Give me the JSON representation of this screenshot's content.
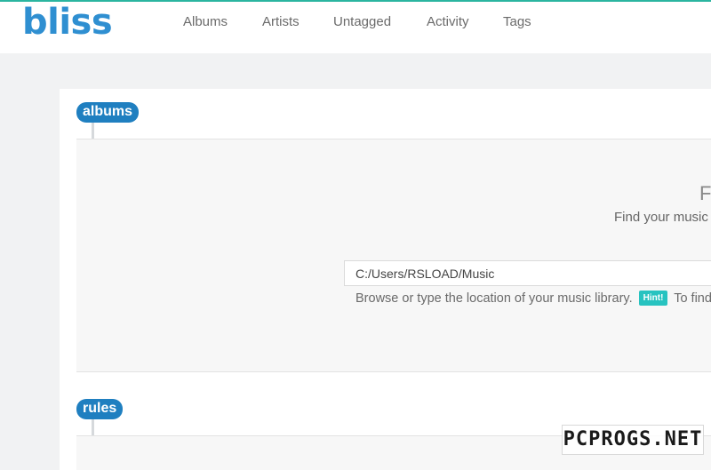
{
  "app": {
    "logo": "bliss"
  },
  "nav": {
    "items": [
      {
        "label": "Albums"
      },
      {
        "label": "Artists"
      },
      {
        "label": "Untagged"
      },
      {
        "label": "Activity"
      },
      {
        "label": "Tags"
      }
    ]
  },
  "sections": {
    "albums": {
      "label": "albums",
      "heading_letter": "F",
      "subtitle": "Find your music",
      "library_path": "C:/Users/RSLOAD/Music",
      "helper_text": "Browse or type the location of your music library.",
      "hint_label": "Hint!",
      "helper_text_tail": "To find"
    },
    "rules": {
      "label": "rules"
    }
  },
  "watermark": {
    "text": "PCPROGS.NET"
  },
  "colors": {
    "brand_blue": "#2f8fd1",
    "pill_blue": "#1f7fc0",
    "hint_teal": "#27c3c0",
    "top_border": "#2bb5a0"
  }
}
